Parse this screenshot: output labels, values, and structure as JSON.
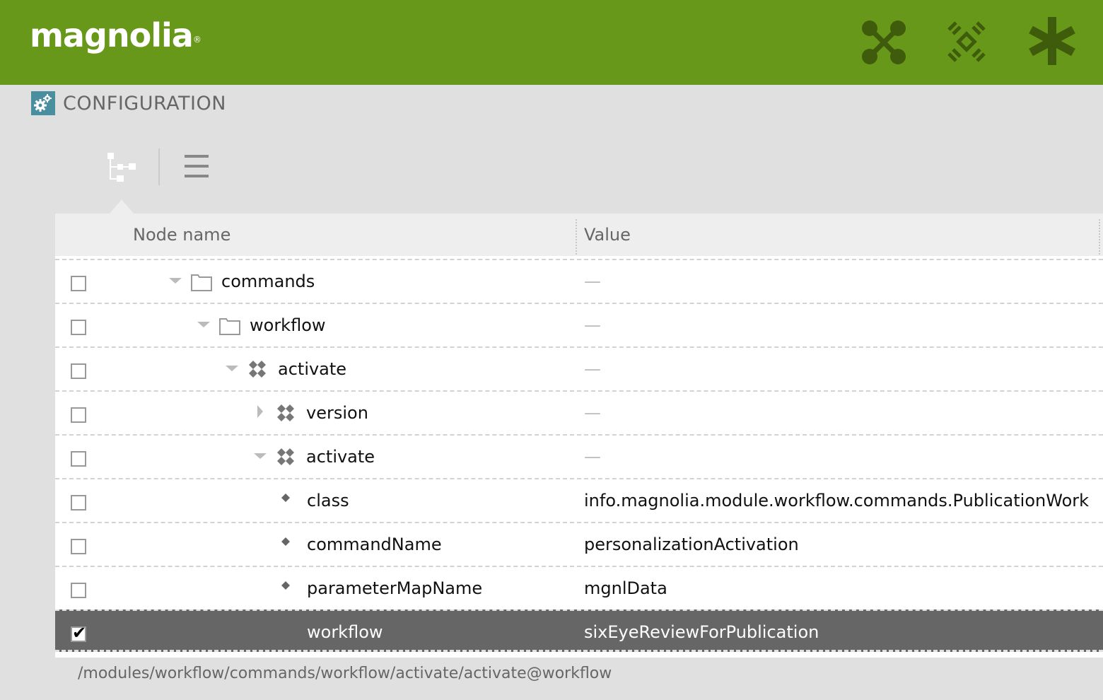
{
  "app": {
    "brand": "magnolia",
    "brand_mark": "®",
    "title": "CONFIGURATION",
    "colors": {
      "header": "#689819",
      "header_icon": "#3f5c0c",
      "app_icon": "#4a8fa0",
      "selected_row": "#666666"
    }
  },
  "top_icons": [
    {
      "name": "apps-launcher-icon"
    },
    {
      "name": "pulse-icon"
    },
    {
      "name": "favorites-icon"
    }
  ],
  "view_switch": {
    "tree_view": "tree-view-icon",
    "list_view": "list-view-icon",
    "active": "tree"
  },
  "grid": {
    "columns": [
      "Node name",
      "Value"
    ],
    "rows": [
      {
        "name": "commands",
        "value": "—",
        "type": "folder",
        "level": 0,
        "toggle": "expanded",
        "checked": false
      },
      {
        "name": "workflow",
        "value": "—",
        "type": "folder",
        "level": 1,
        "toggle": "expanded",
        "checked": false
      },
      {
        "name": "activate",
        "value": "—",
        "type": "content-node",
        "level": 2,
        "toggle": "expanded",
        "checked": false
      },
      {
        "name": "version",
        "value": "—",
        "type": "content-node",
        "level": 3,
        "toggle": "collapsed",
        "checked": false
      },
      {
        "name": "activate",
        "value": "—",
        "type": "content-node",
        "level": 3,
        "toggle": "expanded",
        "checked": false
      },
      {
        "name": "class",
        "value": "info.magnolia.module.workflow.commands.PublicationWork",
        "type": "property",
        "level": 4,
        "toggle": "none",
        "checked": false
      },
      {
        "name": "commandName",
        "value": "personalizationActivation",
        "type": "property",
        "level": 4,
        "toggle": "none",
        "checked": false
      },
      {
        "name": "parameterMapName",
        "value": "mgnlData",
        "type": "property",
        "level": 4,
        "toggle": "none",
        "checked": false
      },
      {
        "name": "workflow",
        "value": "sixEyeReviewForPublication",
        "type": "property",
        "level": 4,
        "toggle": "none",
        "checked": true,
        "selected": true
      }
    ]
  },
  "status": {
    "path": "/modules/workflow/commands/workflow/activate/activate@workflow"
  }
}
